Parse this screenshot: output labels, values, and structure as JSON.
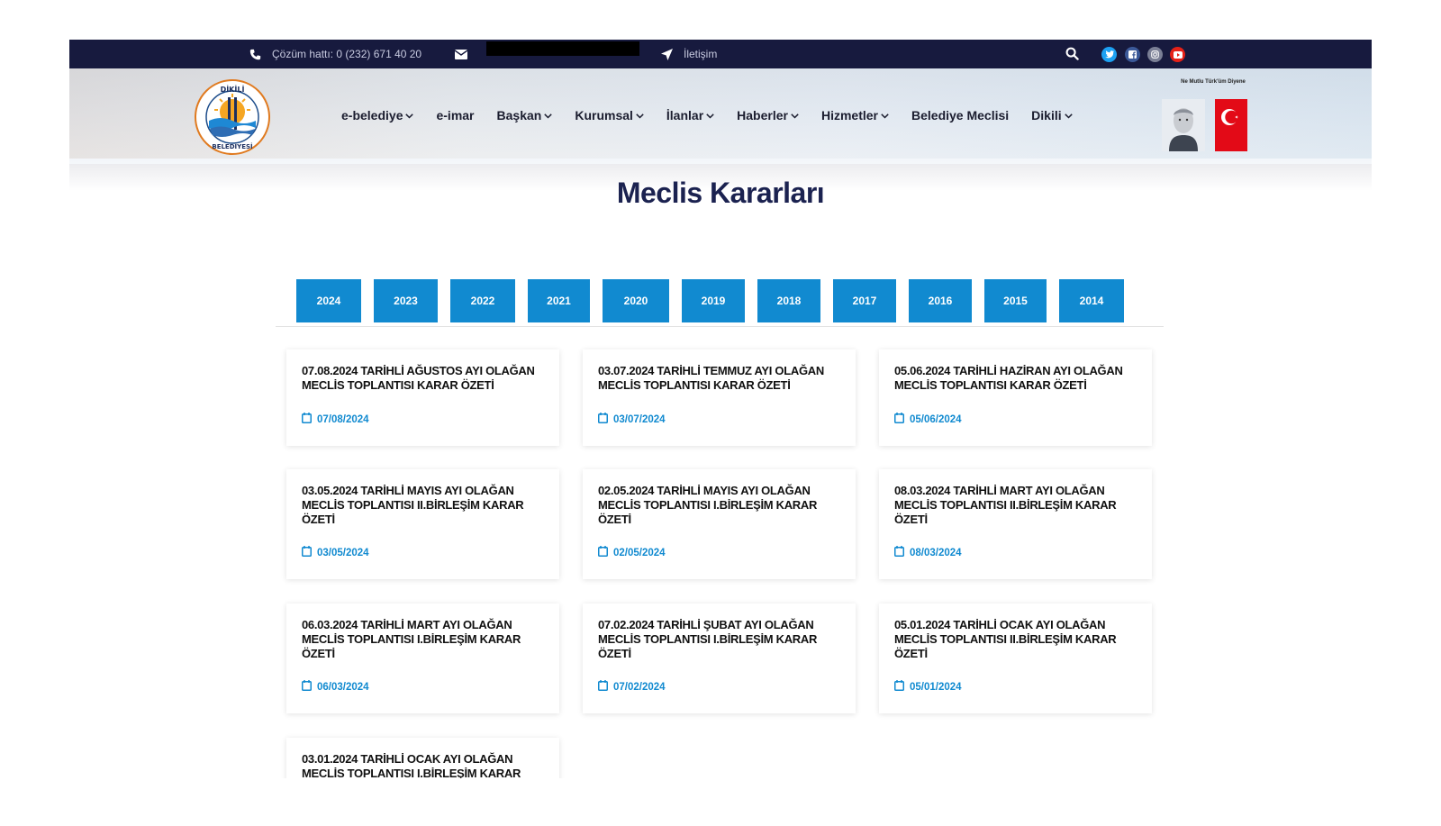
{
  "topbar": {
    "phone_text": "Çözüm hattı: 0 (232) 671 40 20",
    "contact_text": "İletişim"
  },
  "header": {
    "logo_text": "DİKİLİ BELEDİYESİ",
    "ataturk_caption": "Ne Mutlu Türk'üm Diyene"
  },
  "nav": [
    {
      "label": "e-belediye",
      "has_dropdown": true
    },
    {
      "label": "e-imar",
      "has_dropdown": false
    },
    {
      "label": "Başkan",
      "has_dropdown": true
    },
    {
      "label": "Kurumsal",
      "has_dropdown": true
    },
    {
      "label": "İlanlar",
      "has_dropdown": true
    },
    {
      "label": "Haberler",
      "has_dropdown": true
    },
    {
      "label": "Hizmetler",
      "has_dropdown": true
    },
    {
      "label": "Belediye Meclisi",
      "has_dropdown": false
    },
    {
      "label": "Dikili",
      "has_dropdown": true
    }
  ],
  "page": {
    "title": "Meclis Kararları"
  },
  "years": [
    "2024",
    "2023",
    "2022",
    "2021",
    "2020",
    "2019",
    "2018",
    "2017",
    "2016",
    "2015",
    "2014"
  ],
  "decisions": [
    {
      "title": "07.08.2024 TARİHLİ AĞUSTOS AYI OLAĞAN MECLİS TOPLANTISI KARAR ÖZETİ",
      "date": "07/08/2024"
    },
    {
      "title": "03.07.2024 TARİHLİ TEMMUZ AYI OLAĞAN MECLİS TOPLANTISI KARAR ÖZETİ",
      "date": "03/07/2024"
    },
    {
      "title": "05.06.2024 TARİHLİ HAZİRAN AYI OLAĞAN MECLİS TOPLANTISI KARAR ÖZETİ",
      "date": "05/06/2024"
    },
    {
      "title": "03.05.2024 TARİHLİ MAYIS AYI OLAĞAN MECLİS TOPLANTISI II.BİRLEŞİM KARAR ÖZETİ",
      "date": "03/05/2024"
    },
    {
      "title": "02.05.2024 TARİHLİ MAYIS AYI OLAĞAN MECLİS TOPLANTISI I.BİRLEŞİM KARAR ÖZETİ",
      "date": "02/05/2024"
    },
    {
      "title": "08.03.2024 TARİHLİ MART AYI OLAĞAN MECLİS TOPLANTISI II.BİRLEŞİM KARAR ÖZETİ",
      "date": "08/03/2024"
    },
    {
      "title": "06.03.2024 TARİHLİ MART AYI OLAĞAN MECLİS TOPLANTISI I.BİRLEŞİM KARAR ÖZETİ",
      "date": "06/03/2024"
    },
    {
      "title": "07.02.2024 TARİHLİ ŞUBAT AYI OLAĞAN MECLİS TOPLANTISI I.BİRLEŞİM KARAR ÖZETİ",
      "date": "07/02/2024"
    },
    {
      "title": "05.01.2024 TARİHLİ OCAK AYI OLAĞAN MECLİS TOPLANTISI II.BİRLEŞİM KARAR ÖZETİ",
      "date": "05/01/2024"
    },
    {
      "title": "03.01.2024 TARİHLİ OCAK AYI OLAĞAN MECLİS TOPLANTISI I.BİRLEŞİM KARAR",
      "date": ""
    }
  ],
  "colors": {
    "topbar_bg": "#171a3e",
    "accent_blue": "#118ad0",
    "title_navy": "#1b2250",
    "twitter": "#1da1f2",
    "facebook": "#3b5998",
    "instagram": "#7a7f95",
    "youtube": "#e62117",
    "flag_red": "#e30a17"
  },
  "icons": {
    "phone": "phone-icon",
    "email": "envelope-icon",
    "contact": "location-arrow-icon",
    "search": "search-icon",
    "date": "calendar-icon"
  }
}
